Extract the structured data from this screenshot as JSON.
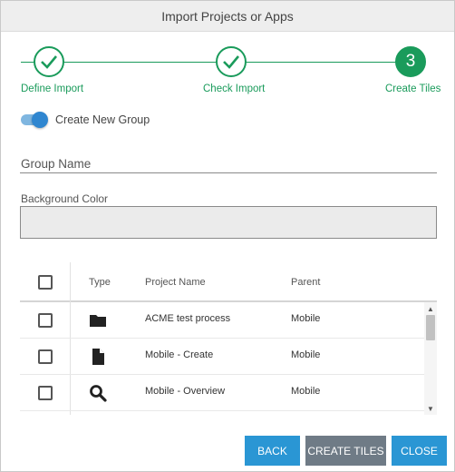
{
  "dialog": {
    "title": "Import Projects or Apps"
  },
  "stepper": {
    "steps": [
      {
        "label": "Define Import",
        "state": "done"
      },
      {
        "label": "Check Import",
        "state": "done"
      },
      {
        "label": "Create Tiles",
        "state": "active",
        "number": "3"
      }
    ],
    "color": "#1a9b5b"
  },
  "form": {
    "toggle_label": "Create New Group",
    "toggle_on": true,
    "group_name_label": "Group Name",
    "group_name_value": "",
    "background_color_label": "Background Color"
  },
  "table": {
    "columns": [
      "Type",
      "Project Name",
      "Parent"
    ],
    "rows": [
      {
        "type_icon": "folder-icon",
        "project_name": "ACME test process",
        "parent": "Mobile",
        "checked": false
      },
      {
        "type_icon": "file-icon",
        "project_name": "Mobile - Create",
        "parent": "Mobile",
        "checked": false
      },
      {
        "type_icon": "search-icon",
        "project_name": "Mobile - Overview",
        "parent": "Mobile",
        "checked": false
      }
    ]
  },
  "buttons": {
    "back": "BACK",
    "create_tiles": "CREATE TILES",
    "close": "CLOSE"
  },
  "colors": {
    "accent_green": "#1a9b5b",
    "button_blue": "#2a96d4",
    "button_gray": "#6f7b86",
    "toggle_blue": "#2f86d0"
  }
}
